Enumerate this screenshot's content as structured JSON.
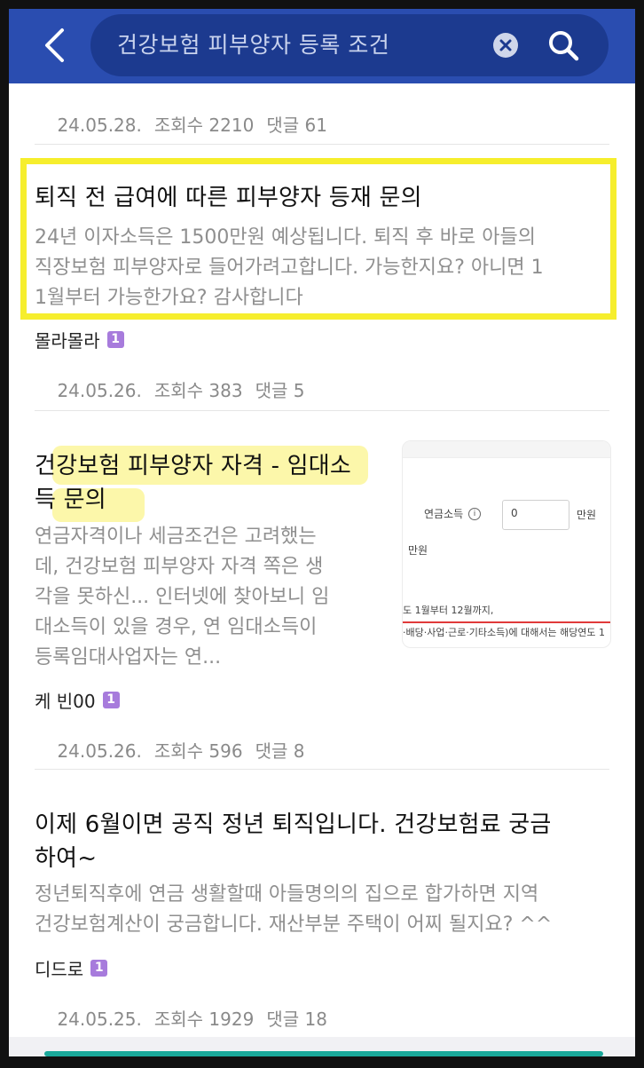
{
  "search": {
    "query": "건강보험 피부양자 등록 조건"
  },
  "colors": {
    "header": "#2a4db0",
    "highlight_box": "#f6ee2d",
    "badge": "#a77bdc"
  },
  "prev_item": {
    "date": "24.05.28.",
    "views": "조회수 2210",
    "comments": "댓글 61"
  },
  "posts": [
    {
      "title": "퇴직 전 급여에 따른 피부양자 등재 문의",
      "desc_lines": [
        "24년 이자소득은 1500만원 예상됩니다. 퇴직 후 바로 아들의",
        "직장보험 피부양자로 들어가려고합니다. 가능한지요? 아니면 1",
        "1월부터 가능한가요? 감사합니다"
      ],
      "author": "몰라몰라",
      "badge": "1",
      "date": "24.05.26.",
      "views": "조회수 383",
      "comments": "댓글 5"
    },
    {
      "title_lines": [
        "건강보험 피부양자 자격 - 임대소",
        "득 문의"
      ],
      "desc_lines": [
        "연금자격이나 세금조건은 고려했는",
        "데, 건강보험 피부양자 자격 쪽은 생",
        "각을 못하신... 인터넷에 찾아보니 임",
        "대소득이 있을 경우, 연 임대소득이",
        "등록임대사업자는 연..."
      ],
      "author": "케 빈00",
      "badge": "1",
      "date": "24.05.26.",
      "views": "조회수 596",
      "comments": "댓글 8",
      "thumbnail": {
        "label": "연금소득",
        "value": "0",
        "unit": "만원",
        "unit2": "만원",
        "line1": "도 1월부터 12월까지,",
        "line2": "·배당·사업·근로·기타소득)에 대해서는 해당연도 1"
      }
    },
    {
      "title_lines": [
        "이제 6월이면 공직 정년 퇴직입니다. 건강보험료 궁금",
        "하여~"
      ],
      "desc_lines": [
        "정년퇴직후에 연금 생활할때 아들명의의 집으로 합가하면 지역",
        "건강보험계산이 궁금합니다. 재산부분 주택이 어찌 될지요? ^^"
      ],
      "author": "디드로",
      "badge": "1",
      "date": "24.05.25.",
      "views": "조회수 1929",
      "comments": "댓글 18"
    }
  ]
}
